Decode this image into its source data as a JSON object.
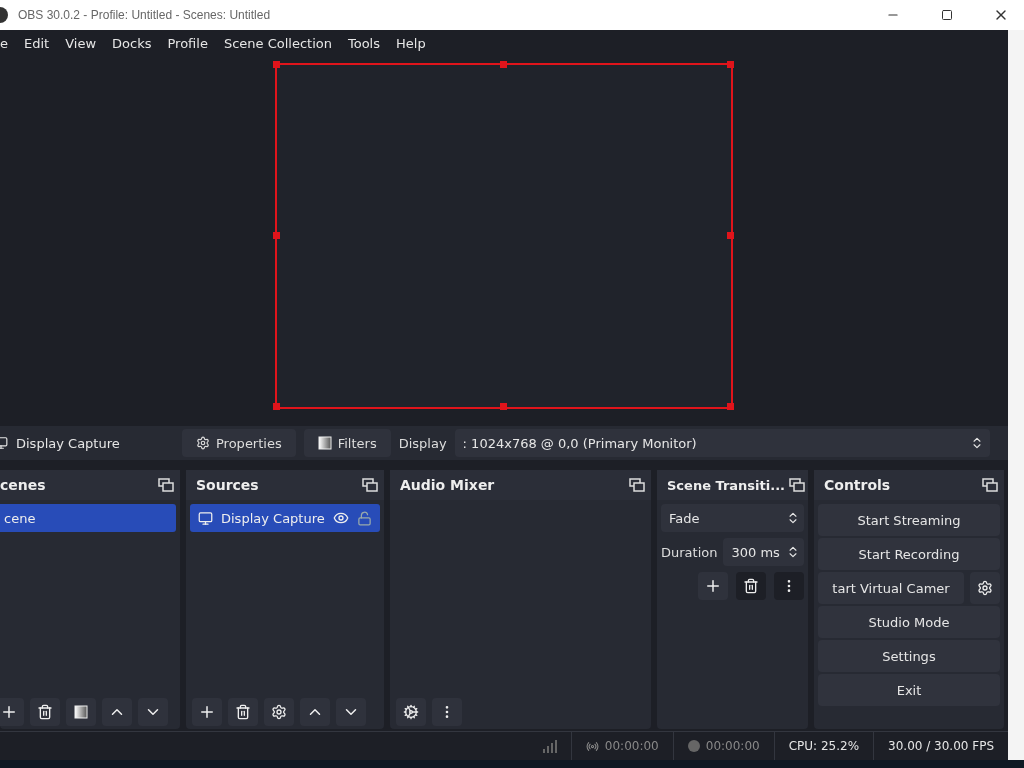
{
  "window": {
    "title": "OBS 30.0.2 - Profile: Untitled - Scenes: Untitled"
  },
  "menu": [
    "e",
    "Edit",
    "View",
    "Docks",
    "Profile",
    "Scene Collection",
    "Tools",
    "Help"
  ],
  "source_toolbar": {
    "source": "Display Capture",
    "buttons": [
      "Properties",
      "Filters"
    ],
    "display_label": "Display",
    "display_value": ": 1024x768 @ 0,0 (Primary Monitor)"
  },
  "docks": {
    "scenes": {
      "title": "cenes",
      "items": [
        {
          "label": "cene",
          "selected": true
        }
      ]
    },
    "sources": {
      "title": "Sources",
      "items": [
        {
          "label": "Display Capture",
          "selected": true,
          "visible": true,
          "locked": false
        }
      ]
    },
    "audio_mixer": {
      "title": "Audio Mixer"
    },
    "transitions": {
      "title": "Scene Transiti...",
      "transition": "Fade",
      "duration_label": "Duration",
      "duration": "300 ms"
    },
    "controls": {
      "title": "Controls",
      "buttons": [
        {
          "label": "Start Streaming",
          "kind": "plain"
        },
        {
          "label": "Start Recording",
          "kind": "plain"
        },
        {
          "label": "tart Virtual Camer",
          "kind": "split"
        },
        {
          "label": "Studio Mode",
          "kind": "plain"
        },
        {
          "label": "Settings",
          "kind": "plain"
        },
        {
          "label": "Exit",
          "kind": "plain"
        }
      ]
    }
  },
  "status_bar": {
    "stream_time": "00:00:00",
    "record_time": "00:00:00",
    "cpu": "CPU: 25.2%",
    "fps": "30.00 / 30.00 FPS"
  }
}
